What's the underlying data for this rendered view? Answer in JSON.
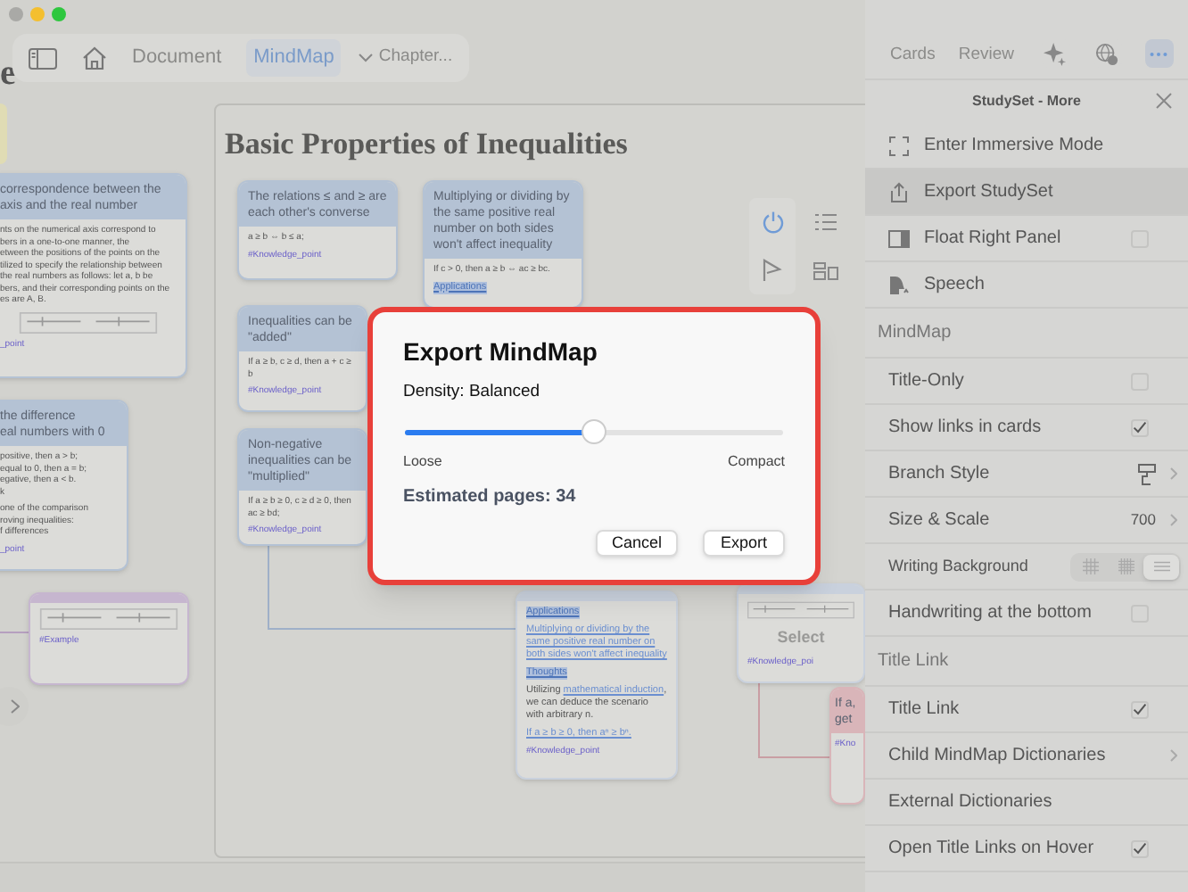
{
  "toolbar": {
    "tabs": [
      {
        "label": "Document",
        "selected": false
      },
      {
        "label": "MindMap",
        "selected": true
      }
    ],
    "chapter": "Chapter..."
  },
  "canvas": {
    "left_frame_title": "e",
    "frame_title": "Basic Properties of Inequalities",
    "cards": [
      {
        "title": "correspondence between the\naxis and the real number",
        "color": "#b4c2d4",
        "blocks": [
          {
            "kind": "text",
            "text": "nts on the numerical axis correspond to\nbers in a one-to-one manner, the\netween the positions of the points on the\ntilized to specify the relationship between\nthe real numbers as follows: let a, b be\nbers, and their corresponding points on the\nes are A, B."
          },
          {
            "kind": "figure"
          },
          {
            "kind": "tag",
            "text": "_point"
          }
        ]
      },
      {
        "title": "the difference\neal numbers with 0",
        "color": "#b4c2d4",
        "blocks": [
          {
            "kind": "text",
            "text": "positive, then a > b;\nequal to 0, then a = b;\negative, then a < b.\nk"
          },
          {
            "kind": "text",
            "text": "one of the comparison\nroving inequalities:\nf differences"
          },
          {
            "kind": "tag",
            "text": "_point"
          }
        ]
      },
      {
        "color": "#c6b6cf",
        "blocks": [
          {
            "kind": "figure"
          },
          {
            "kind": "tag",
            "text": "#Example"
          }
        ]
      },
      {
        "title": "The relations ≤ and ≥ are each other's converse",
        "color": "#b4c2d4",
        "blocks": [
          {
            "kind": "text",
            "text": "a ≥ b ⇔ b ≤ a;"
          },
          {
            "kind": "tag",
            "text": "#Knowledge_point"
          }
        ]
      },
      {
        "title": "Inequalities can be \"added\"",
        "color": "#b4c2d4",
        "blocks": [
          {
            "kind": "text",
            "text": "If a ≥ b, c ≥ d, then a + c ≥ b"
          },
          {
            "kind": "tag",
            "text": "#Knowledge_point"
          }
        ]
      },
      {
        "title": "Non-negative inequalities can be \"multiplied\"",
        "color": "#b4c2d4",
        "blocks": [
          {
            "kind": "text",
            "text": "If a ≥ b ≥ 0, c ≥ d ≥ 0, then ac ≥ bd;"
          },
          {
            "kind": "tag",
            "text": "#Knowledge_point"
          }
        ]
      },
      {
        "title": "Multiplying or dividing by the same positive real number on both sides won't affect inequality",
        "color": "#b4c2d4",
        "blocks": [
          {
            "kind": "text",
            "text": "If c > 0, then a ≥ b ⇔ ac ≥ bc."
          },
          {
            "kind": "highlight",
            "text": "Applications"
          }
        ]
      },
      {
        "color": "#c9d1dd",
        "blocks": [
          {
            "kind": "highlight",
            "text": "Applications"
          },
          {
            "kind": "link",
            "text": "Multiplying or dividing by the same positive real number on both sides won't affect inequality"
          },
          {
            "kind": "highlight",
            "text": "Thoughts"
          },
          {
            "kind": "mixed",
            "parts": [
              {
                "text": "Utilizing ",
                "link": false
              },
              {
                "text": "mathematical induction",
                "link": true
              },
              {
                "text": ", we can deduce the scenario with arbitrary n.",
                "link": false
              }
            ]
          },
          {
            "kind": "link",
            "text": "If a ≥ b ≥ 0, then aⁿ ≥ bⁿ."
          },
          {
            "kind": "tag",
            "text": "#Knowledge_point"
          }
        ]
      },
      {
        "color": "#c9d1dd",
        "blocks": [
          {
            "kind": "figure"
          },
          {
            "kind": "label",
            "text": "Select"
          },
          {
            "kind": "tag",
            "text": "#Knowledge_poi"
          }
        ]
      },
      {
        "title": "If a,\nget",
        "color": "#d9b5b9",
        "blocks": [
          {
            "kind": "tag",
            "text": "#Kno"
          }
        ]
      }
    ]
  },
  "dialog": {
    "title": "Export MindMap",
    "density_label": "Density: Balanced",
    "slider": {
      "level": 0.5
    },
    "min_label": "Loose",
    "max_label": "Compact",
    "estimate": "Estimated pages: 34",
    "buttons": [
      "Cancel",
      "Export"
    ]
  },
  "panel": {
    "tabs": [
      {
        "label": "Cards",
        "selected": false
      },
      {
        "label": "Review",
        "selected": false
      }
    ],
    "icon_buttons": [
      {
        "selected": false
      },
      {
        "selected": false
      },
      {
        "selected": true
      }
    ],
    "title": "StudySet - More",
    "items": [
      {
        "kind": "action",
        "label": "Enter Immersive Mode",
        "selected": false
      },
      {
        "kind": "action",
        "label": "Export StudySet",
        "selected": true
      },
      {
        "kind": "action",
        "label": "Float Right Panel",
        "selected": false,
        "checked": false
      },
      {
        "kind": "action",
        "label": "Speech",
        "selected": false
      },
      {
        "kind": "section",
        "label": "MindMap"
      },
      {
        "kind": "checkbox",
        "label": "Title-Only",
        "checked": false
      },
      {
        "kind": "checkbox",
        "label": "Show links in cards",
        "checked": true
      },
      {
        "kind": "submenu",
        "label": "Branch Style"
      },
      {
        "kind": "submenu",
        "label": "Size & Scale",
        "value": "700"
      },
      {
        "kind": "segmented",
        "label": "Writing Background",
        "segments": [
          {
            "selected": false
          },
          {
            "selected": false
          },
          {
            "selected": true
          }
        ]
      },
      {
        "kind": "checkbox",
        "label": "Handwriting at the bottom",
        "checked": false
      },
      {
        "kind": "section",
        "label": "Title Link"
      },
      {
        "kind": "checkbox",
        "label": "Title Link",
        "checked": true
      },
      {
        "kind": "submenu",
        "label": "Child MindMap Dictionaries"
      },
      {
        "kind": "plain",
        "label": "External Dictionaries"
      },
      {
        "kind": "checkbox",
        "label": "Open Title Links on Hover",
        "checked": true
      }
    ]
  }
}
